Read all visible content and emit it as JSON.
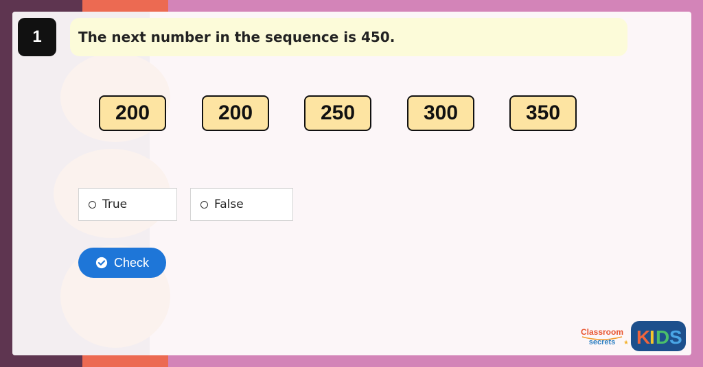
{
  "question": {
    "number": "1",
    "text": "The next number in the sequence is 450."
  },
  "sequence": [
    "200",
    "200",
    "250",
    "300",
    "350"
  ],
  "options": [
    {
      "label": "True",
      "selected": false
    },
    {
      "label": "False",
      "selected": false
    }
  ],
  "check_button": {
    "label": "Check",
    "icon": "check-circle-icon"
  },
  "logos": {
    "classroom_secrets": {
      "line1": "Classroom",
      "line2": "secrets"
    },
    "kids": "KIDS"
  },
  "colors": {
    "background": "#d384b8",
    "left_band": "#5e3550",
    "coral_band": "#ec6a52",
    "question_bubble": "#fcfbd9",
    "number_box": "#fde4a2",
    "check_button": "#1e76d8"
  }
}
